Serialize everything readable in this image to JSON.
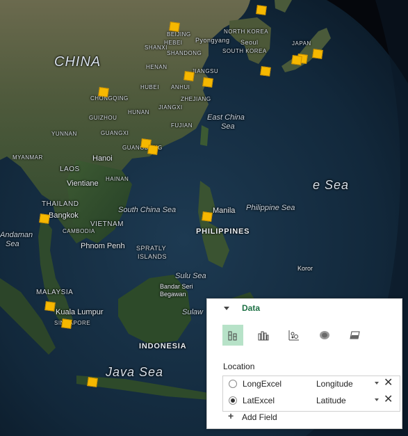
{
  "map": {
    "labels": {
      "china": "CHINA",
      "north_korea": "NORTH KOREA",
      "pyongyang": "Pyongyang",
      "seoul": "Seoul",
      "south_korea": "SOUTH KOREA",
      "japan": "JAPAN",
      "beijing": "BEIJING",
      "hebei": "HEBEI",
      "shanxi": "SHANXI",
      "shandong": "SHANDONG",
      "henan": "HENAN",
      "jiangsu": "JIANGSU",
      "hubei": "HUBEI",
      "anhui": "ANHUI",
      "zhejiang": "ZHEJIANG",
      "jiangxi": "JIANGXI",
      "chongqing": "CHONGQING",
      "guizhou": "GUIZHOU",
      "hunan": "HUNAN",
      "fujian": "FUJIAN",
      "yunnan": "YUNNAN",
      "guangxi": "GUANGXI",
      "guangdong": "GUANGDONG",
      "east_china_sea_1": "East China",
      "east_china_sea_2": "Sea",
      "myanmar": "MYANMAR",
      "hanoi": "Hanoi",
      "laos": "LAOS",
      "hainan": "HAINAN",
      "vientiane": "Vientiane",
      "thailand": "THAILAND",
      "bangkok": "Bangkok",
      "cambodia": "CAMBODIA",
      "vietnam": "VIETNAM",
      "phnom_penh": "Phnom Penh",
      "south_china_sea": "South China Sea",
      "manila": "Manila",
      "philippines": "PHILIPPINES",
      "philippine_sea": "Philippine Sea",
      "e_sea": "e Sea",
      "andaman_1": "Andaman",
      "andaman_2": "Sea",
      "spratly_1": "SPRATLY",
      "spratly_2": "ISLANDS",
      "sulu_sea": "Sulu Sea",
      "koror": "Koror",
      "malaysia": "MALAYSIA",
      "bandar_1": "Bandar Seri",
      "bandar_2": "Begawan",
      "kuala_lumpur": "Kuala Lumpur",
      "singapore": "SINGAPORE",
      "sulawesi": "Sulaw",
      "indonesia": "INDONESIA",
      "java_sea": "Java Sea"
    },
    "marker_color": "#f6b800",
    "marker_count": 18
  },
  "panel": {
    "section_title": "Data",
    "toolbar": [
      {
        "icon": "stacked-column-icon",
        "selected": true
      },
      {
        "icon": "clustered-column-icon",
        "selected": false
      },
      {
        "icon": "bubble-icon",
        "selected": false
      },
      {
        "icon": "heat-map-icon",
        "selected": false
      },
      {
        "icon": "region-icon",
        "selected": false
      }
    ],
    "location_label": "Location",
    "fields": [
      {
        "name": "LongExcel",
        "type": "Longitude",
        "selected": false
      },
      {
        "name": "LatExcel",
        "type": "Latitude",
        "selected": true
      }
    ],
    "add_field_label": "Add Field",
    "accent_color": "#1e7145"
  }
}
